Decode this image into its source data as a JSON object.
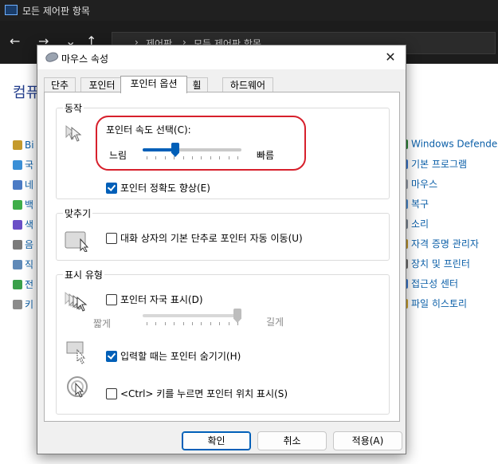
{
  "background": {
    "window_title": "모든 제어판 항목",
    "breadcrumb": [
      "제어판",
      "모든 제어판 항목"
    ],
    "heading": "컴퓨",
    "left_items": [
      "Bi",
      "국",
      "네",
      "백",
      "색",
      "음",
      "직",
      "전",
      "키"
    ],
    "right_items": [
      "Windows Defender",
      "기본 프로그램",
      "마우스",
      "복구",
      "소리",
      "자격 증명 관리자",
      "장치 및 프린터",
      "접근성 센터",
      "파일 히스토리"
    ]
  },
  "dialog": {
    "title": "마우스 속성",
    "close_label": "✕",
    "tabs": [
      "단추",
      "포인터",
      "포인터 옵션",
      "휠",
      "하드웨어"
    ],
    "active_tab": "포인터 옵션",
    "motion": {
      "group_title": "동작",
      "speed_label": "포인터 속도 선택(C):",
      "slow_label": "느림",
      "fast_label": "빠름",
      "speed_value": 0.32,
      "precision_label": "포인터 정확도 향상(E)",
      "precision_checked": true
    },
    "snap_to": {
      "group_title": "맞추기",
      "label": "대화 상자의 기본 단추로 포인터 자동 이동(U)",
      "checked": false
    },
    "visibility": {
      "group_title": "표시 유형",
      "trails_label": "포인터 자국 표시(D)",
      "trails_checked": false,
      "short_label": "짧게",
      "long_label": "길게",
      "trails_value": 1.0,
      "hide_label": "입력할 때는 포인터 숨기기(H)",
      "hide_checked": true,
      "ctrl_label": "<Ctrl> 키를 누르면 포인터 위치 표시(S)",
      "ctrl_checked": false
    },
    "buttons": {
      "ok": "확인",
      "cancel": "취소",
      "apply": "적용(A)"
    }
  },
  "colors": {
    "accent": "#005fb8",
    "highlight": "#d7202c",
    "link": "#0b5fa8"
  }
}
